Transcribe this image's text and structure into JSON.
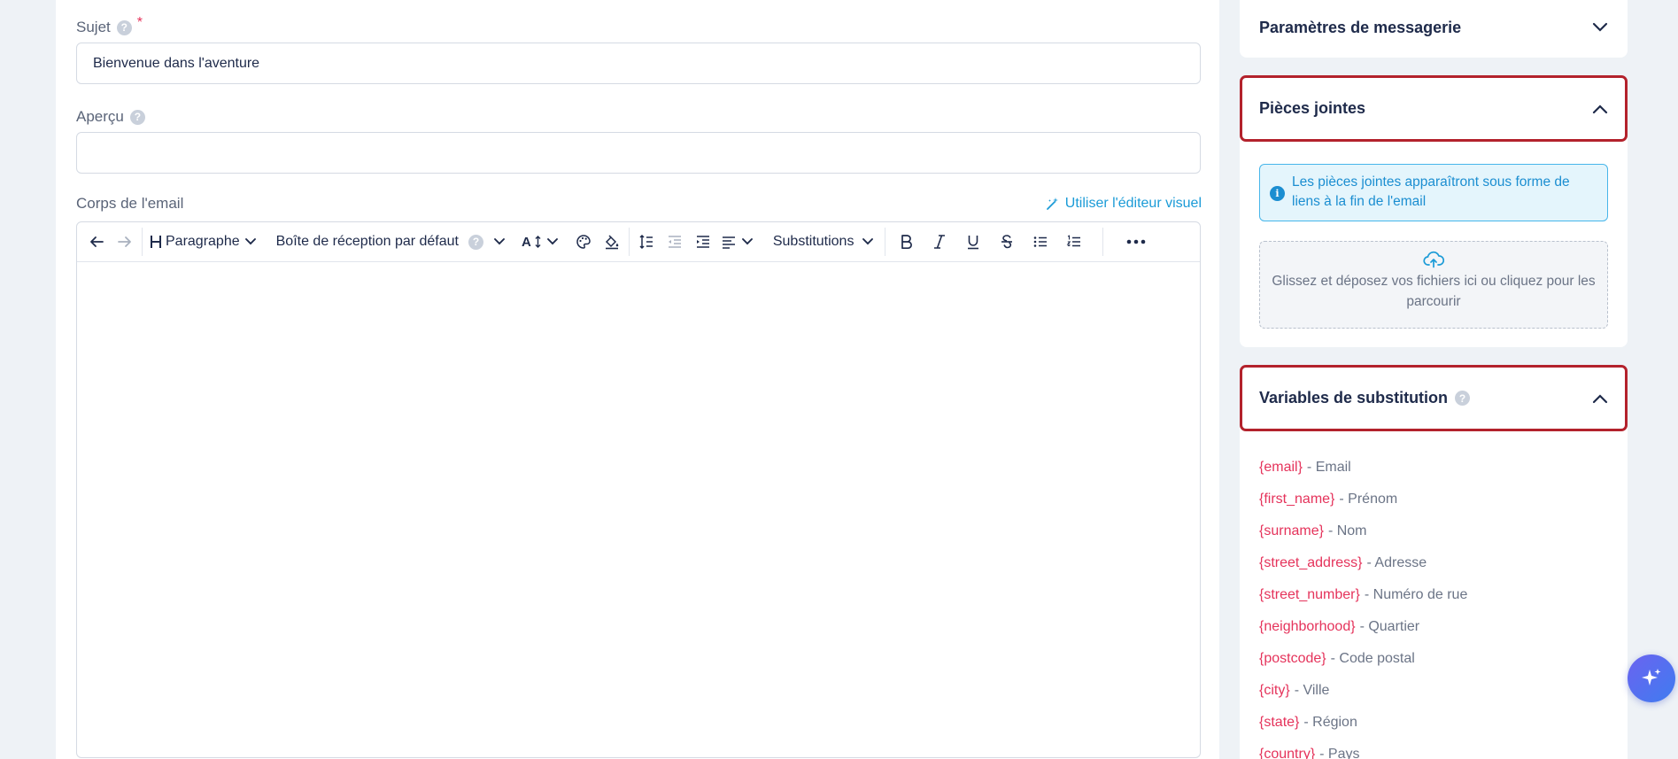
{
  "form": {
    "subject_label": "Sujet",
    "subject_required": "*",
    "subject_value": "Bienvenue dans l'aventure",
    "preview_label": "Aperçu",
    "preview_value": "",
    "body_label": "Corps de l'email",
    "visual_editor_link": "Utiliser l'éditeur visuel"
  },
  "toolbar": {
    "paragraph": "Paragraphe",
    "inbox": "Boîte de réception par défaut",
    "font_size": "A",
    "substitutions": "Substitutions"
  },
  "panel": {
    "messaging_params": "Paramètres de messagerie",
    "attachments": {
      "title": "Pièces jointes",
      "info": "Les pièces jointes apparaîtront sous forme de liens à la fin de l'email",
      "dropzone": "Glissez et déposez vos fichiers ici ou cliquez pour les parcourir"
    },
    "variables": {
      "title": "Variables de substitution",
      "items": [
        {
          "key": "{email}",
          "label": "- Email"
        },
        {
          "key": "{first_name}",
          "label": "- Prénom"
        },
        {
          "key": "{surname}",
          "label": "- Nom"
        },
        {
          "key": "{street_address}",
          "label": "- Adresse"
        },
        {
          "key": "{street_number}",
          "label": "- Numéro de rue"
        },
        {
          "key": "{neighborhood}",
          "label": "- Quartier"
        },
        {
          "key": "{postcode}",
          "label": "- Code postal"
        },
        {
          "key": "{city}",
          "label": "- Ville"
        },
        {
          "key": "{state}",
          "label": "- Région"
        },
        {
          "key": "{country}",
          "label": "- Pays"
        }
      ]
    }
  },
  "colors": {
    "accent_blue": "#1b9bd7",
    "variable_red": "#e5335b",
    "highlight_border": "#b3222c"
  }
}
